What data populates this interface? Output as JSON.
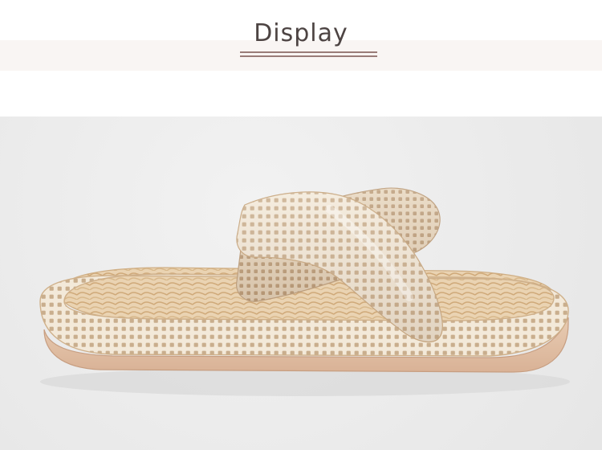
{
  "header": {
    "title": "Display"
  },
  "colors": {
    "title_text": "#4d4443",
    "accent_rule": "#9a7c78",
    "band_background": "#f9f5f3",
    "photo_background": "#ececec",
    "slipper_fabric": "#f1e6d5",
    "slipper_dots": "#cdb493",
    "sole": "#e1c2a8"
  }
}
